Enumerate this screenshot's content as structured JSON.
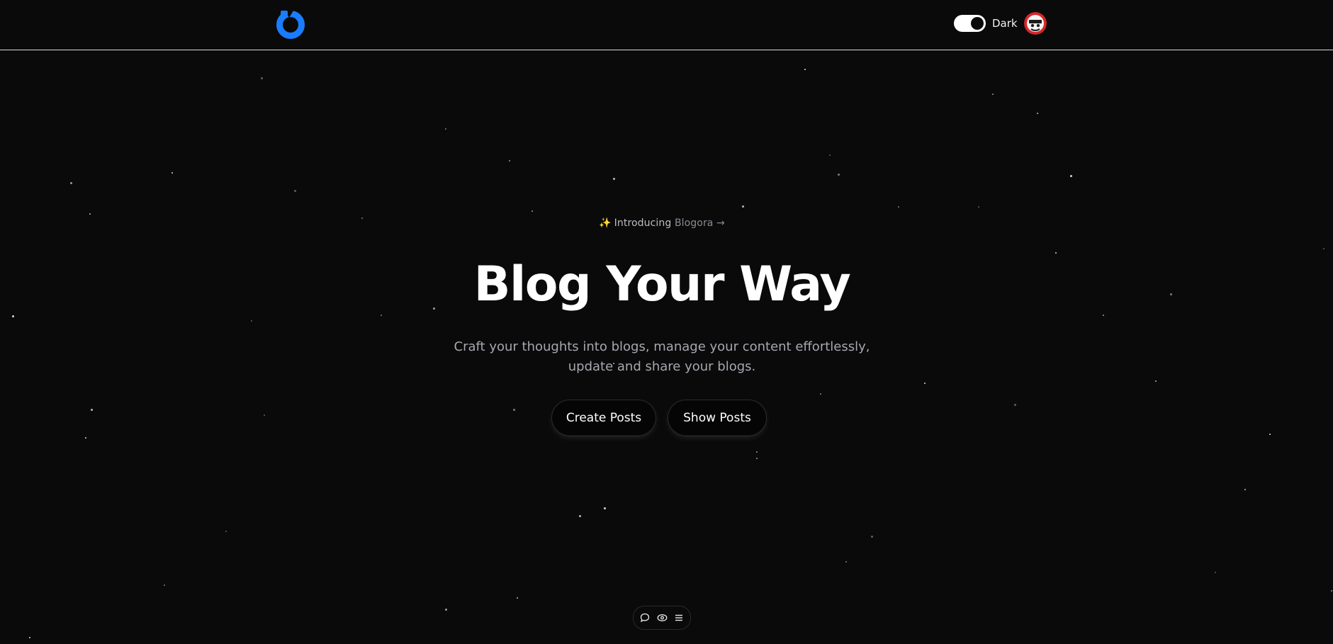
{
  "header": {
    "logo_icon": "blogora-logo-icon",
    "theme_toggle": {
      "label": "Dark",
      "state": "on"
    },
    "avatar_icon": "user-avatar-icon"
  },
  "hero": {
    "intro": {
      "sparkle": "✨",
      "label_strong": "Introducing",
      "label_muted": " Blogora →"
    },
    "title": "Blog Your Way",
    "subtitle_line1": "Craft your thoughts into blogs, manage your content effortlessly,",
    "subtitle_line2": "update and share your blogs.",
    "buttons": {
      "create": "Create Posts",
      "show": "Show Posts"
    }
  },
  "dock": {
    "icons": [
      "chat-icon",
      "eye-icon",
      "menu-icon"
    ]
  },
  "colors": {
    "background": "#0a0a0b",
    "accent": "#1a7cff",
    "text": "#ffffff",
    "muted_text": "#a7a7ae"
  }
}
